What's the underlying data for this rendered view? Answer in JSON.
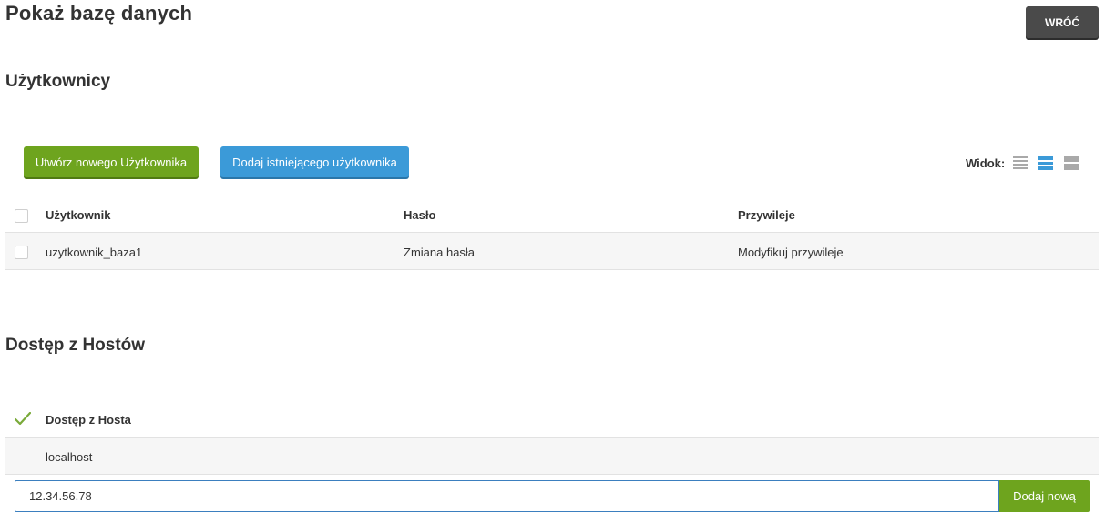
{
  "page": {
    "title": "Pokaż bazę danych",
    "back_label": "WRÓĆ"
  },
  "users": {
    "heading": "Użytkownicy",
    "create_label": "Utwórz nowego Użytkownika",
    "add_existing_label": "Dodaj istniejącego użytkownika",
    "view_label": "Widok:",
    "columns": [
      "Użytkownik",
      "Hasło",
      "Przywileje"
    ],
    "rows": [
      {
        "user": "uzytkownik_baza1",
        "password": "Zmiana hasła",
        "privileges": "Modyfikuj przywileje"
      }
    ]
  },
  "hosts": {
    "heading": "Dostęp z Hostów",
    "column": "Dostęp z Hosta",
    "rows": [
      "localhost"
    ],
    "input_value": "12.34.56.78",
    "add_label": "Dodaj nową"
  },
  "colors": {
    "green": "#6ea41e",
    "blue": "#3b9ad8",
    "dark": "#4a4a4a"
  }
}
